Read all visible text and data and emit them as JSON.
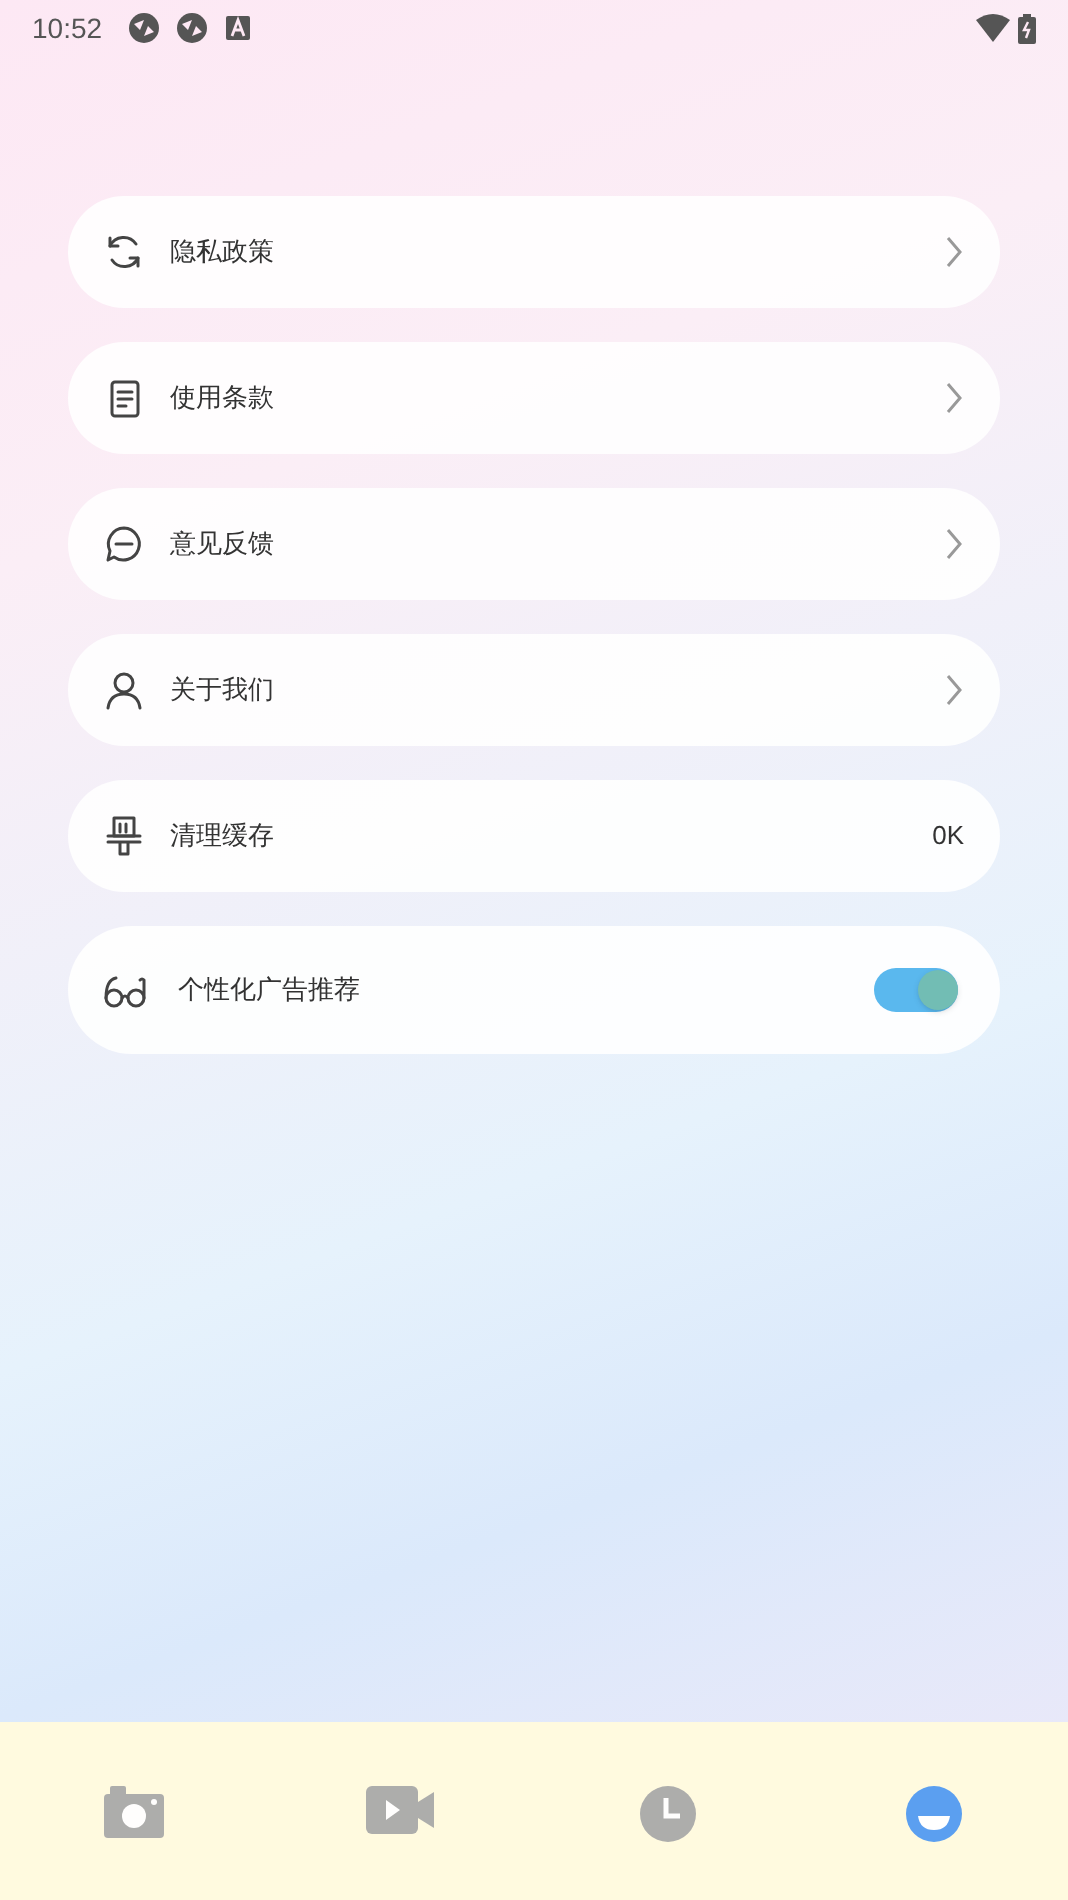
{
  "status_bar": {
    "time": "10:52"
  },
  "settings": [
    {
      "kind": "link",
      "label": "隐私政策"
    },
    {
      "kind": "link",
      "label": "使用条款"
    },
    {
      "kind": "link",
      "label": "意见反馈"
    },
    {
      "kind": "link",
      "label": "关于我们"
    },
    {
      "kind": "value",
      "label": "清理缓存",
      "value": "0K"
    },
    {
      "kind": "toggle",
      "label": "个性化广告推荐",
      "on": true
    }
  ],
  "bottom_nav": [
    {
      "selected": false
    },
    {
      "selected": false
    },
    {
      "selected": false
    },
    {
      "selected": true
    }
  ]
}
